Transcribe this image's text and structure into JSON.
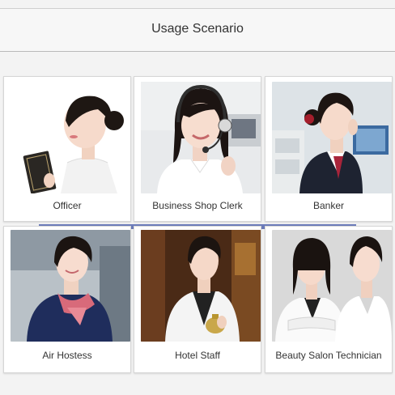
{
  "header": {
    "title": "Usage Scenario"
  },
  "cards": [
    {
      "label": "Officer"
    },
    {
      "label": "Business Shop Clerk"
    },
    {
      "label": "Banker"
    },
    {
      "label": "Air Hostess"
    },
    {
      "label": "Hotel Staff"
    },
    {
      "label": "Beauty Salon Technician"
    }
  ],
  "colors": {
    "accent_bar": "#5d6fb4",
    "background": "#f3f3f3",
    "card": "#ffffff"
  }
}
